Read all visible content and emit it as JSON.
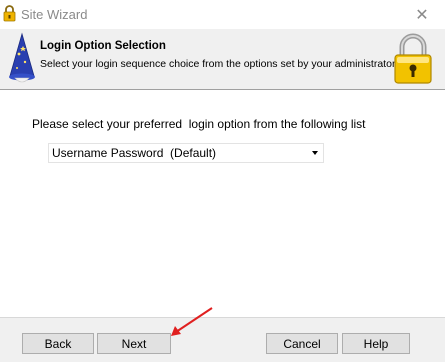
{
  "window": {
    "title": "Site Wizard",
    "close_glyph": "✕"
  },
  "header": {
    "title": "Login Option Selection",
    "subtitle": "Select your login sequence choice from the options set by your administrator",
    "left_icon": "wizard-icon",
    "right_icon": "padlock-icon"
  },
  "content": {
    "instruction": "Please select your preferred  login option from the following list",
    "login_select": {
      "selected": "Username Password  (Default)"
    }
  },
  "footer": {
    "back_label": "Back",
    "next_label": "Next",
    "cancel_label": "Cancel",
    "help_label": "Help"
  },
  "annotation": {
    "arrow_color": "#e02020"
  }
}
